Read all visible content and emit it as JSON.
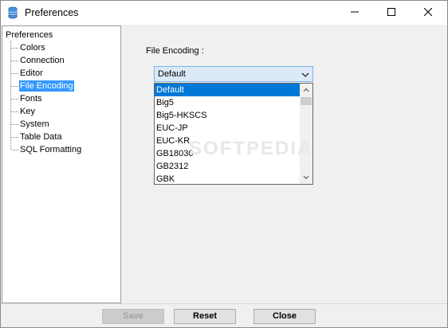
{
  "window": {
    "title": "Preferences",
    "controls": {
      "minimize": "minimize",
      "maximize": "maximize",
      "close": "close"
    }
  },
  "tree": {
    "root": "Preferences",
    "items": [
      {
        "label": "Colors",
        "selected": false
      },
      {
        "label": "Connection",
        "selected": false
      },
      {
        "label": "Editor",
        "selected": false
      },
      {
        "label": "File Encoding",
        "selected": true
      },
      {
        "label": "Fonts",
        "selected": false
      },
      {
        "label": "Key",
        "selected": false
      },
      {
        "label": "System",
        "selected": false
      },
      {
        "label": "Table Data",
        "selected": false
      },
      {
        "label": "SQL Formatting",
        "selected": false
      }
    ]
  },
  "encoding": {
    "label": "File Encoding :",
    "selected": "Default",
    "options": [
      "Default",
      "Big5",
      "Big5-HKSCS",
      "EUC-JP",
      "EUC-KR",
      "GB18030",
      "GB2312",
      "GBK"
    ]
  },
  "watermark": "SOFTPEDIA",
  "buttons": {
    "save": "Save",
    "reset": "Reset",
    "close": "Close"
  },
  "colors": {
    "selection": "#3399ff",
    "list_selection": "#0078d7",
    "combo_bg": "#dbe9f9"
  }
}
